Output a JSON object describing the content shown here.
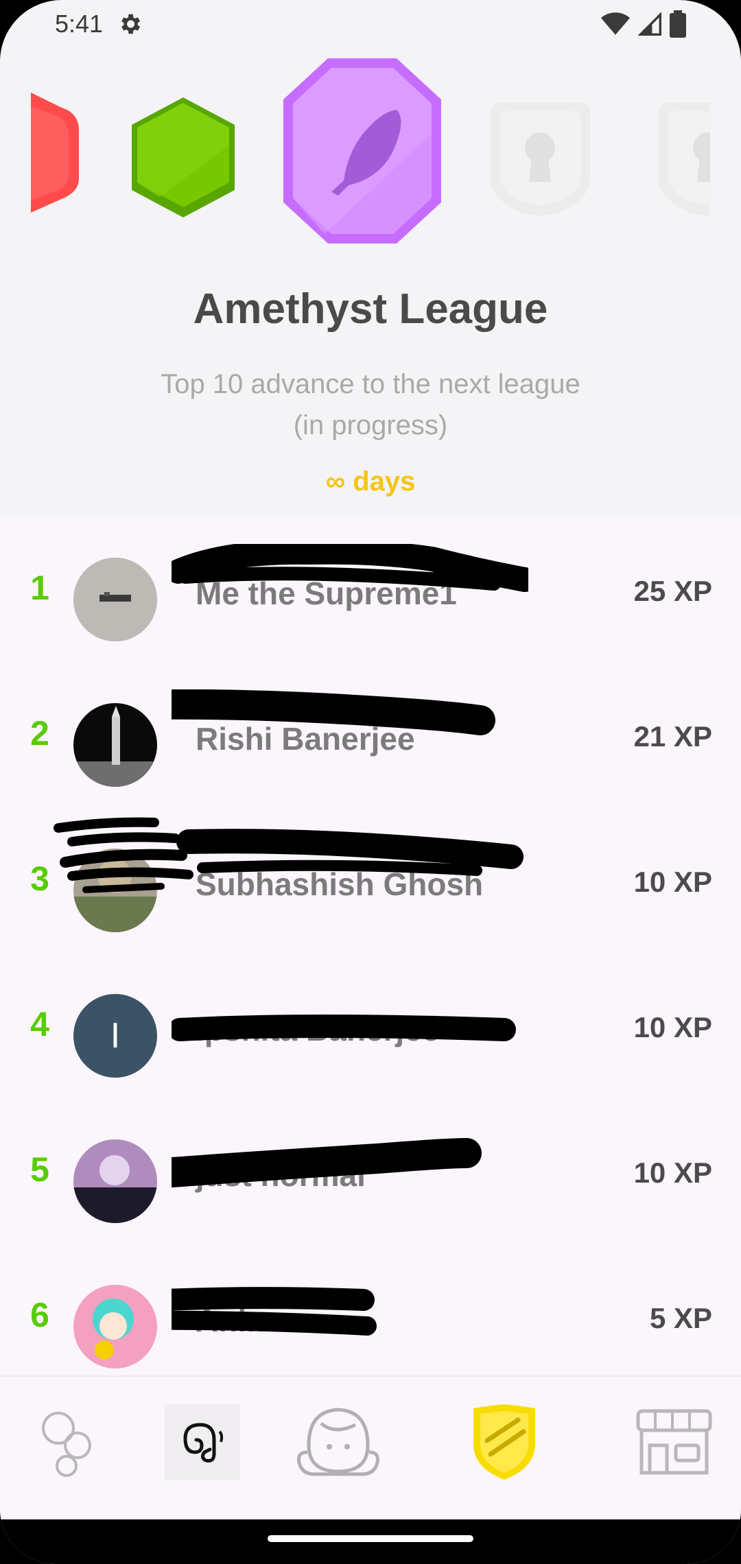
{
  "status_bar": {
    "time": "5:41",
    "settings_icon": "gear-icon",
    "wifi_icon": "wifi-icon",
    "signal_icon": "signal-icon",
    "battery_icon": "battery-icon"
  },
  "header": {
    "title": "Amethyst League",
    "subtitle_line1": "Top 10 advance to the next league",
    "subtitle_line2": "(in progress)",
    "time_left": "∞ days",
    "badges": [
      {
        "name": "ruby-badge",
        "color": "#ff4b4b"
      },
      {
        "name": "emerald-badge",
        "color": "#78c800"
      },
      {
        "name": "amethyst-badge",
        "color": "#ce82ff"
      },
      {
        "name": "locked-badge",
        "color": "#e5e5e5"
      },
      {
        "name": "locked-badge",
        "color": "#e5e5e5"
      }
    ]
  },
  "leaderboard": [
    {
      "rank": "1",
      "name": "Me the Supreme1",
      "xp": "25 XP"
    },
    {
      "rank": "2",
      "name": "Rishi Banerjee",
      "xp": "21 XP"
    },
    {
      "rank": "3",
      "name": "Subhashish Ghosh",
      "xp": "10 XP"
    },
    {
      "rank": "4",
      "name": "Ipshita Banerjee",
      "xp": "10 XP"
    },
    {
      "rank": "5",
      "name": "just normal",
      "xp": "10 XP"
    },
    {
      "rank": "6",
      "name": "Anime",
      "xp": "5 XP"
    }
  ],
  "avatar_letter_4": "I",
  "bottom_nav": [
    "learn-tab",
    "letters-tab",
    "profile-tab",
    "leagues-tab",
    "shop-tab"
  ],
  "colors": {
    "accent_green": "#58cc02",
    "gold": "#f5c518",
    "amethyst": "#ce82ff",
    "league_active": "#ffde00"
  }
}
